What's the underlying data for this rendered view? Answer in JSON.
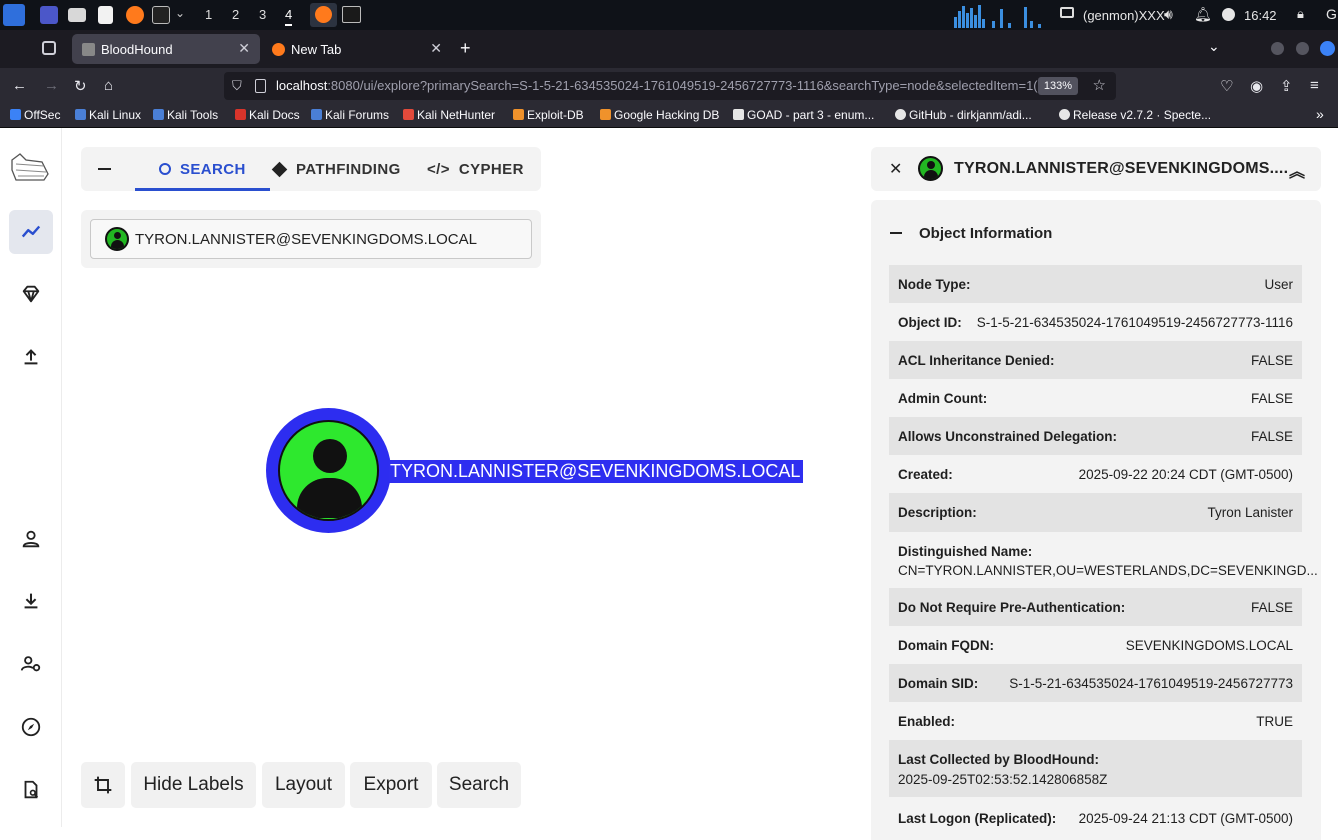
{
  "panel": {
    "workspaces": [
      "1",
      "2",
      "3",
      "4"
    ],
    "active_workspace": "4",
    "genmon": "(genmon)XXX",
    "clock": "16:42"
  },
  "browser": {
    "tabs": [
      {
        "label": "BloodHound",
        "active": true
      },
      {
        "label": "New Tab",
        "active": false
      }
    ],
    "new_tab_glyph": "+",
    "url_host": "localhost",
    "url_rest": ":8080/ui/explore?primarySearch=S-1-5-21-634535024-1761049519-2456727773-1116&searchType=node&selectedItem=1(",
    "zoom": "133%",
    "bookmarks": [
      {
        "label": "OffSec",
        "color": "#3b82f6"
      },
      {
        "label": "Kali Linux",
        "color": "#4a7fd6"
      },
      {
        "label": "Kali Tools",
        "color": "#4a7fd6"
      },
      {
        "label": "Kali Docs",
        "color": "#d9342b"
      },
      {
        "label": "Kali Forums",
        "color": "#4a7fd6"
      },
      {
        "label": "Kali NetHunter",
        "color": "#e24a3b"
      },
      {
        "label": "Exploit-DB",
        "color": "#f0922b"
      },
      {
        "label": "Google Hacking DB",
        "color": "#f0922b"
      },
      {
        "label": "GOAD - part 3 - enum...",
        "color": "#e6e6e6"
      },
      {
        "label": "GitHub - dirkjanm/adi...",
        "color": "#e6e6e6"
      },
      {
        "label": "Release v2.7.2 · Specte...",
        "color": "#e6e6e6"
      }
    ]
  },
  "explore": {
    "tabs": {
      "search": "SEARCH",
      "pathfinding": "PATHFINDING",
      "cypher": "CYPHER"
    },
    "search_value": "TYRON.LANNISTER@SEVENKINGDOMS.LOCAL",
    "node_label": "TYRON.LANNISTER@SEVENKINGDOMS.LOCAL",
    "toolbar": {
      "hide_labels": "Hide Labels",
      "layout": "Layout",
      "export": "Export",
      "search": "Search"
    }
  },
  "entity_panel": {
    "title": "TYRON.LANNISTER@SEVENKINGDOMS....",
    "section_title": "Object Information",
    "rows": [
      {
        "key": "Node Type:",
        "value": "User"
      },
      {
        "key": "Object ID:",
        "value": "S-1-5-21-634535024-1761049519-2456727773-1116"
      },
      {
        "key": "ACL Inheritance Denied:",
        "value": "FALSE"
      },
      {
        "key": "Admin Count:",
        "value": "FALSE"
      },
      {
        "key": "Allows Unconstrained Delegation:",
        "value": "FALSE"
      },
      {
        "key": "Created:",
        "value": "2025-09-22 20:24 CDT (GMT-0500)"
      },
      {
        "key": "Description:",
        "value": "Tyron Lanister"
      },
      {
        "key": "Distinguished Name:",
        "value": "CN=TYRON.LANNISTER,OU=WESTERLANDS,DC=SEVENKINGD..."
      },
      {
        "key": "Do Not Require Pre-Authentication:",
        "value": "FALSE"
      },
      {
        "key": "Domain FQDN:",
        "value": "SEVENKINGDOMS.LOCAL"
      },
      {
        "key": "Domain SID:",
        "value": "S-1-5-21-634535024-1761049519-2456727773"
      },
      {
        "key": "Enabled:",
        "value": "TRUE"
      },
      {
        "key": "Last Collected by BloodHound:",
        "value": "2025-09-25T02:53:52.142806858Z"
      },
      {
        "key": "Last Logon (Replicated):",
        "value": "2025-09-24 21:13 CDT (GMT-0500)"
      }
    ]
  },
  "colors": {
    "accent": "#2a4fcf",
    "node_ring": "#2d2df0",
    "node_fill": "#2ee82e"
  }
}
